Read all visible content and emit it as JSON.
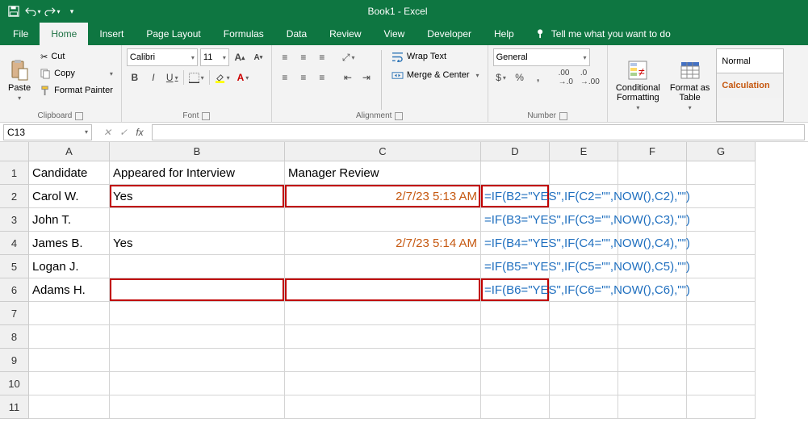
{
  "title": "Book1 - Excel",
  "menu": {
    "file": "File",
    "home": "Home",
    "insert": "Insert",
    "pagelayout": "Page Layout",
    "formulas": "Formulas",
    "data": "Data",
    "review": "Review",
    "view": "View",
    "developer": "Developer",
    "help": "Help",
    "tellme": "Tell me what you want to do"
  },
  "ribbon": {
    "clipboard": {
      "paste": "Paste",
      "cut": "Cut",
      "copy": "Copy",
      "formatpainter": "Format Painter",
      "label": "Clipboard"
    },
    "font": {
      "name": "Calibri",
      "size": "11",
      "label": "Font"
    },
    "alignment": {
      "wrap": "Wrap Text",
      "merge": "Merge & Center",
      "label": "Alignment"
    },
    "number": {
      "format": "General",
      "label": "Number"
    },
    "styles": {
      "cond": "Conditional\nFormatting",
      "fmtTable": "Format as\nTable",
      "normal": "Normal",
      "calc": "Calculation"
    }
  },
  "namebox": "C13",
  "formula": "",
  "columns": [
    "A",
    "B",
    "C",
    "D",
    "E",
    "F",
    "G"
  ],
  "rows": [
    "1",
    "2",
    "3",
    "4",
    "5",
    "6",
    "7",
    "8",
    "9",
    "10",
    "11"
  ],
  "cells": {
    "A1": "Candidate",
    "B1": "Appeared for Interview",
    "C1": "Manager Review",
    "A2": "Carol W.",
    "B2": "Yes",
    "C2": "2/7/23 5:13 AM",
    "D2": "=IF(B2=\"YES\",IF(C2=\"\",NOW(),C2),\"\")",
    "A3": "John T.",
    "D3": "=IF(B3=\"YES\",IF(C3=\"\",NOW(),C3),\"\")",
    "A4": "James B.",
    "B4": "Yes",
    "C4": "2/7/23 5:14 AM",
    "D4": "=IF(B4=\"YES\",IF(C4=\"\",NOW(),C4),\"\")",
    "A5": "Logan J.",
    "D5": "=IF(B5=\"YES\",IF(C5=\"\",NOW(),C5),\"\")",
    "A6": "Adams H.",
    "D6": "=IF(B6=\"YES\",IF(C6=\"\",NOW(),C6),\"\")"
  },
  "highlights": [
    "B2",
    "C2",
    "D2",
    "B6",
    "C6",
    "D6"
  ],
  "dateCells": [
    "C2",
    "C4"
  ],
  "formulaCells": [
    "D2",
    "D3",
    "D4",
    "D5",
    "D6"
  ]
}
